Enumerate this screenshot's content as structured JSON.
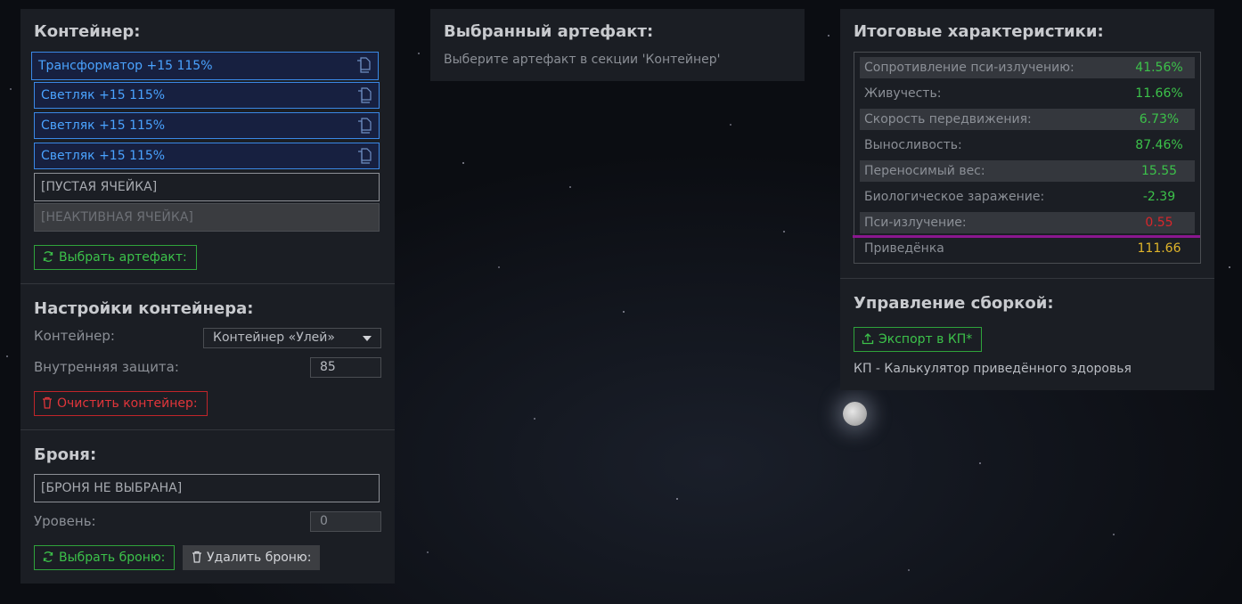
{
  "container_section": {
    "title": "Контейнер:",
    "slots": [
      {
        "label": "Трансформатор +15 115%"
      },
      {
        "label": "Светляк +15 115%"
      },
      {
        "label": "Светляк +15 115%"
      },
      {
        "label": "Светляк +15 115%"
      }
    ],
    "empty_slot": "[ПУСТАЯ ЯЧЕЙКА]",
    "inactive_slot": "[НЕАКТИВНАЯ ЯЧЕЙКА]",
    "select_artifact_button": "Выбрать артефакт:"
  },
  "container_settings": {
    "title": "Настройки контейнера:",
    "container_label": "Контейнер:",
    "container_value": "Контейнер «Улей»",
    "inner_protection_label": "Внутренняя защита:",
    "inner_protection_value": "85",
    "clear_button": "Очистить контейнер:"
  },
  "armor": {
    "title": "Броня:",
    "armor_value": "[БРОНЯ НЕ ВЫБРАНА]",
    "level_label": "Уровень:",
    "level_value": "0",
    "select_button": "Выбрать броню:",
    "delete_button": "Удалить броню:"
  },
  "selected_artifact": {
    "title": "Выбранный артефакт:",
    "hint": "Выберите артефакт в секции 'Контейнер'"
  },
  "totals": {
    "title": "Итоговые характеристики:",
    "stats": [
      {
        "name": "Сопротивление пси-излучению:",
        "value": "41.56%",
        "color": "#3cc24a"
      },
      {
        "name": "Живучесть:",
        "value": "11.66%",
        "color": "#3cc24a"
      },
      {
        "name": "Скорость передвижения:",
        "value": "6.73%",
        "color": "#3cc24a"
      },
      {
        "name": "Выносливость:",
        "value": "87.46%",
        "color": "#3cc24a"
      },
      {
        "name": "Переносимый вес:",
        "value": "15.55",
        "color": "#3cc24a"
      },
      {
        "name": "Биологическое заражение:",
        "value": "-2.39",
        "color": "#3cc24a"
      },
      {
        "name": "Пси-излучение:",
        "value": "0.55",
        "color": "#d9262b"
      }
    ],
    "effective": {
      "name": "Приведёнка",
      "value": "111.66",
      "color": "#e0b52a"
    }
  },
  "build": {
    "title": "Управление сборкой:",
    "export_button": "Экспорт в КП*",
    "footnote": "КП - Калькулятор приведённого здоровья"
  },
  "colors": {
    "accent_green": "#3cc24a",
    "accent_blue": "#4aa3ff",
    "accent_red": "#e0353a",
    "accent_purple": "#8a178f"
  }
}
